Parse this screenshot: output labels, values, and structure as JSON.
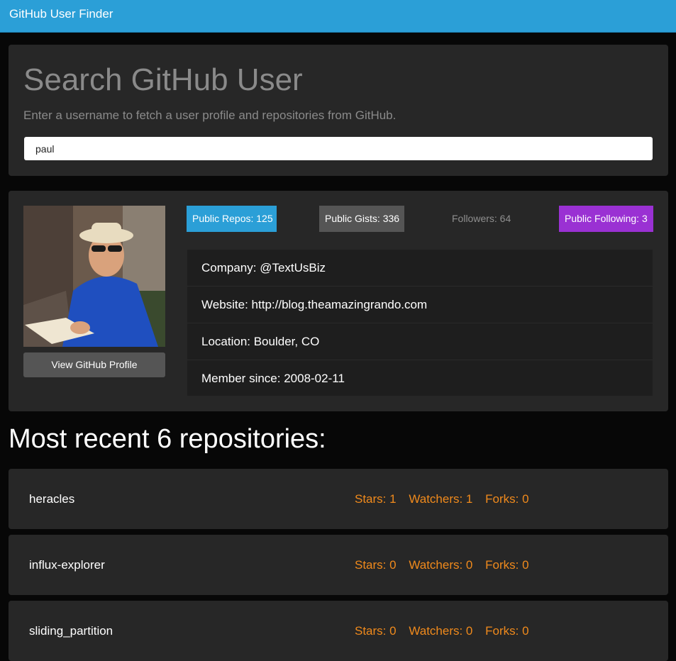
{
  "navbar": {
    "brand": "GitHub User Finder"
  },
  "search": {
    "title": "Search GitHub User",
    "subtitle": "Enter a username to fetch a user profile and repositories from GitHub.",
    "value": "paul"
  },
  "profile": {
    "view_button": "View GitHub Profile",
    "badges": {
      "repos": "Public Repos: 125",
      "gists": "Public Gists: 336",
      "followers": "Followers: 64",
      "following": "Public Following: 3"
    },
    "info": {
      "company": "Company: @TextUsBiz",
      "website": "Website: http://blog.theamazingrando.com",
      "location": "Location: Boulder, CO",
      "member_since": "Member since: 2008-02-11"
    }
  },
  "repos_heading": "Most recent 6 repositories:",
  "repos": [
    {
      "name": "heracles",
      "stars": "Stars: 1",
      "watchers": "Watchers: 1",
      "forks": "Forks: 0"
    },
    {
      "name": "influx-explorer",
      "stars": "Stars: 0",
      "watchers": "Watchers: 0",
      "forks": "Forks: 0"
    },
    {
      "name": "sliding_partition",
      "stars": "Stars: 0",
      "watchers": "Watchers: 0",
      "forks": "Forks: 0"
    }
  ],
  "colors": {
    "navbar": "#2b9fd7",
    "panel": "#272727",
    "repos_badge": "#2b9fd7",
    "gists_badge": "#555555",
    "following_badge": "#9a31d3",
    "repo_stats": "#f08a1c"
  }
}
